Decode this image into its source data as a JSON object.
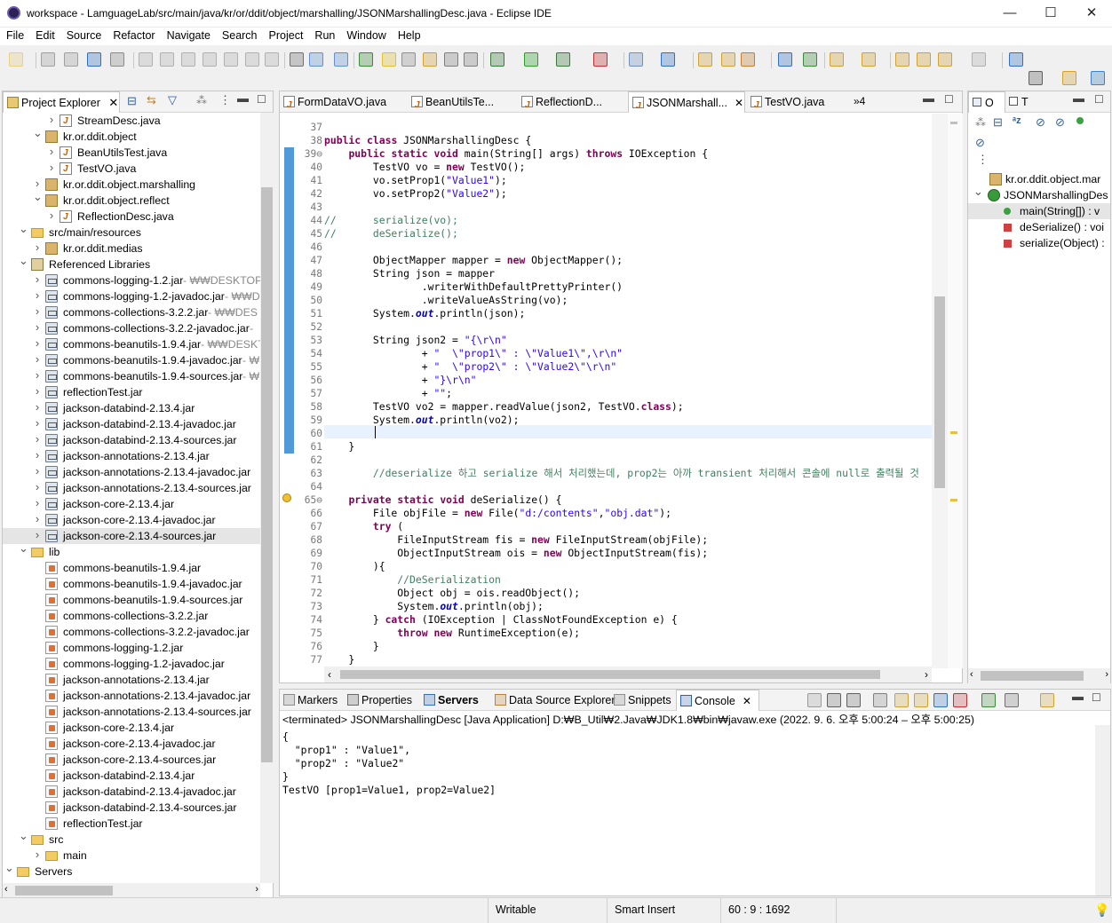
{
  "window": {
    "title": "workspace - LamguageLab/src/main/java/kr/or/ddit/object/marshalling/JSONMarshallingDesc.java - Eclipse IDE",
    "minimize": "—",
    "maximize": "☐",
    "close": "✕"
  },
  "menu": [
    "File",
    "Edit",
    "Source",
    "Refactor",
    "Navigate",
    "Search",
    "Project",
    "Run",
    "Window",
    "Help"
  ],
  "project_explorer": {
    "tab_label": "Project Explorer",
    "rows": [
      {
        "label": "StreamDesc.java",
        "extra": "",
        "indent": 4,
        "icon": "java-file-icon",
        "twisty": ">"
      },
      {
        "label": "kr.or.ddit.object",
        "extra": "",
        "indent": 3,
        "icon": "package-icon",
        "twisty": "v"
      },
      {
        "label": "BeanUtilsTest.java",
        "extra": "",
        "indent": 4,
        "icon": "java-file-icon",
        "twisty": ">"
      },
      {
        "label": "TestVO.java",
        "extra": "",
        "indent": 4,
        "icon": "java-file-icon",
        "twisty": ">"
      },
      {
        "label": "kr.or.ddit.object.marshalling",
        "extra": "",
        "indent": 3,
        "icon": "package-icon",
        "twisty": ">"
      },
      {
        "label": "kr.or.ddit.object.reflect",
        "extra": "",
        "indent": 3,
        "icon": "package-icon",
        "twisty": "v"
      },
      {
        "label": "ReflectionDesc.java",
        "extra": "",
        "indent": 4,
        "icon": "java-file-icon",
        "twisty": ">"
      },
      {
        "label": "src/main/resources",
        "extra": "",
        "indent": 2,
        "icon": "source-folder-icon",
        "twisty": "v"
      },
      {
        "label": "kr.or.ddit.medias",
        "extra": "",
        "indent": 3,
        "icon": "package-icon",
        "twisty": ">"
      },
      {
        "label": "Referenced Libraries",
        "extra": "",
        "indent": 2,
        "icon": "library-icon",
        "twisty": "v"
      },
      {
        "label": "commons-logging-1.2.jar",
        "extra": " - ₩₩DESKTOP",
        "indent": 3,
        "icon": "jar-icon",
        "twisty": ">"
      },
      {
        "label": "commons-logging-1.2-javadoc.jar",
        "extra": " - ₩₩D",
        "indent": 3,
        "icon": "jar-icon",
        "twisty": ">"
      },
      {
        "label": "commons-collections-3.2.2.jar",
        "extra": " - ₩₩DES",
        "indent": 3,
        "icon": "jar-icon",
        "twisty": ">"
      },
      {
        "label": "commons-collections-3.2.2-javadoc.jar",
        "extra": " -",
        "indent": 3,
        "icon": "jar-icon",
        "twisty": ">"
      },
      {
        "label": "commons-beanutils-1.9.4.jar",
        "extra": " - ₩₩DESKT",
        "indent": 3,
        "icon": "jar-icon",
        "twisty": ">"
      },
      {
        "label": "commons-beanutils-1.9.4-javadoc.jar",
        "extra": " - ₩",
        "indent": 3,
        "icon": "jar-icon",
        "twisty": ">"
      },
      {
        "label": "commons-beanutils-1.9.4-sources.jar",
        "extra": " - ₩",
        "indent": 3,
        "icon": "jar-icon",
        "twisty": ">"
      },
      {
        "label": "reflectionTest.jar",
        "extra": "",
        "indent": 3,
        "icon": "jar-icon",
        "twisty": ">"
      },
      {
        "label": "jackson-databind-2.13.4.jar",
        "extra": "",
        "indent": 3,
        "icon": "jar-icon",
        "twisty": ">"
      },
      {
        "label": "jackson-databind-2.13.4-javadoc.jar",
        "extra": "",
        "indent": 3,
        "icon": "jar-icon",
        "twisty": ">"
      },
      {
        "label": "jackson-databind-2.13.4-sources.jar",
        "extra": "",
        "indent": 3,
        "icon": "jar-icon",
        "twisty": ">"
      },
      {
        "label": "jackson-annotations-2.13.4.jar",
        "extra": "",
        "indent": 3,
        "icon": "jar-icon",
        "twisty": ">"
      },
      {
        "label": "jackson-annotations-2.13.4-javadoc.jar",
        "extra": "",
        "indent": 3,
        "icon": "jar-icon",
        "twisty": ">"
      },
      {
        "label": "jackson-annotations-2.13.4-sources.jar",
        "extra": "",
        "indent": 3,
        "icon": "jar-icon",
        "twisty": ">"
      },
      {
        "label": "jackson-core-2.13.4.jar",
        "extra": "",
        "indent": 3,
        "icon": "jar-icon",
        "twisty": ">"
      },
      {
        "label": "jackson-core-2.13.4-javadoc.jar",
        "extra": "",
        "indent": 3,
        "icon": "jar-icon",
        "twisty": ">"
      },
      {
        "label": "jackson-core-2.13.4-sources.jar",
        "extra": "",
        "indent": 3,
        "icon": "jar-icon",
        "twisty": ">",
        "selected": true
      },
      {
        "label": "lib",
        "extra": "",
        "indent": 2,
        "icon": "folder-icon",
        "twisty": "v"
      },
      {
        "label": "commons-beanutils-1.9.4.jar",
        "extra": "",
        "indent": 3,
        "icon": "jar-file-icon",
        "twisty": ""
      },
      {
        "label": "commons-beanutils-1.9.4-javadoc.jar",
        "extra": "",
        "indent": 3,
        "icon": "jar-file-icon",
        "twisty": ""
      },
      {
        "label": "commons-beanutils-1.9.4-sources.jar",
        "extra": "",
        "indent": 3,
        "icon": "jar-file-icon",
        "twisty": ""
      },
      {
        "label": "commons-collections-3.2.2.jar",
        "extra": "",
        "indent": 3,
        "icon": "jar-file-icon",
        "twisty": ""
      },
      {
        "label": "commons-collections-3.2.2-javadoc.jar",
        "extra": "",
        "indent": 3,
        "icon": "jar-file-icon",
        "twisty": ""
      },
      {
        "label": "commons-logging-1.2.jar",
        "extra": "",
        "indent": 3,
        "icon": "jar-file-icon",
        "twisty": ""
      },
      {
        "label": "commons-logging-1.2-javadoc.jar",
        "extra": "",
        "indent": 3,
        "icon": "jar-file-icon",
        "twisty": ""
      },
      {
        "label": "jackson-annotations-2.13.4.jar",
        "extra": "",
        "indent": 3,
        "icon": "jar-file-icon",
        "twisty": ""
      },
      {
        "label": "jackson-annotations-2.13.4-javadoc.jar",
        "extra": "",
        "indent": 3,
        "icon": "jar-file-icon",
        "twisty": ""
      },
      {
        "label": "jackson-annotations-2.13.4-sources.jar",
        "extra": "",
        "indent": 3,
        "icon": "jar-file-icon",
        "twisty": ""
      },
      {
        "label": "jackson-core-2.13.4.jar",
        "extra": "",
        "indent": 3,
        "icon": "jar-file-icon",
        "twisty": ""
      },
      {
        "label": "jackson-core-2.13.4-javadoc.jar",
        "extra": "",
        "indent": 3,
        "icon": "jar-file-icon",
        "twisty": ""
      },
      {
        "label": "jackson-core-2.13.4-sources.jar",
        "extra": "",
        "indent": 3,
        "icon": "jar-file-icon",
        "twisty": ""
      },
      {
        "label": "jackson-databind-2.13.4.jar",
        "extra": "",
        "indent": 3,
        "icon": "jar-file-icon",
        "twisty": ""
      },
      {
        "label": "jackson-databind-2.13.4-javadoc.jar",
        "extra": "",
        "indent": 3,
        "icon": "jar-file-icon",
        "twisty": ""
      },
      {
        "label": "jackson-databind-2.13.4-sources.jar",
        "extra": "",
        "indent": 3,
        "icon": "jar-file-icon",
        "twisty": ""
      },
      {
        "label": "reflectionTest.jar",
        "extra": "",
        "indent": 3,
        "icon": "jar-file-icon",
        "twisty": ""
      },
      {
        "label": "src",
        "extra": "",
        "indent": 2,
        "icon": "folder-icon",
        "twisty": "v"
      },
      {
        "label": "main",
        "extra": "",
        "indent": 3,
        "icon": "folder-icon",
        "twisty": ">"
      },
      {
        "label": "Servers",
        "extra": "",
        "indent": 1,
        "icon": "folder-icon",
        "twisty": "v"
      }
    ]
  },
  "editor": {
    "tabs": [
      {
        "label": "FormDataVO.java",
        "active": false
      },
      {
        "label": "BeanUtilsTe...",
        "active": false
      },
      {
        "label": "ReflectionD...",
        "active": false
      },
      {
        "label": "JSONMarshall...",
        "active": true
      },
      {
        "label": "TestVO.java",
        "active": false
      }
    ],
    "overflow": "»4",
    "lines": [
      {
        "n": "37",
        "html": ""
      },
      {
        "n": "38",
        "html": "<span class='kw'>public</span> <span class='kw'>class</span> JSONMarshallingDesc {"
      },
      {
        "n": "39⊖",
        "html": "    <span class='kw'>public</span> <span class='kw'>static</span> <span class='kw'>void</span> main(String[] args) <span class='kw'>throws</span> IOException {"
      },
      {
        "n": "40",
        "html": "        TestVO vo = <span class='kw'>new</span> TestVO();"
      },
      {
        "n": "41",
        "html": "        vo.setProp1(<span class='str'>\"Value1\"</span>);"
      },
      {
        "n": "42",
        "html": "        vo.setProp2(<span class='str'>\"Value2\"</span>);"
      },
      {
        "n": "43",
        "html": ""
      },
      {
        "n": "44",
        "html": "<span class='cm'>//      serialize(vo);</span>"
      },
      {
        "n": "45",
        "html": "<span class='cm'>//      deSerialize();</span>"
      },
      {
        "n": "46",
        "html": ""
      },
      {
        "n": "47",
        "html": "        ObjectMapper mapper = <span class='kw'>new</span> ObjectMapper();"
      },
      {
        "n": "48",
        "html": "        String json = mapper"
      },
      {
        "n": "49",
        "html": "                .writerWithDefaultPrettyPrinter()"
      },
      {
        "n": "50",
        "html": "                .writeValueAsString(vo);"
      },
      {
        "n": "51",
        "html": "        System.<span class='fld'>out</span>.println(json);"
      },
      {
        "n": "52",
        "html": ""
      },
      {
        "n": "53",
        "html": "        String json2 = <span class='str'>\"{\\r\\n\"</span>"
      },
      {
        "n": "54",
        "html": "                + <span class='str'>\"  \\\"prop1\\\" : \\\"Value1\\\",\\r\\n\"</span>"
      },
      {
        "n": "55",
        "html": "                + <span class='str'>\"  \\\"prop2\\\" : \\\"Value2\\\"\\r\\n\"</span>"
      },
      {
        "n": "56",
        "html": "                + <span class='str'>\"}\\r\\n\"</span>"
      },
      {
        "n": "57",
        "html": "                + <span class='str'>\"\"</span>;"
      },
      {
        "n": "58",
        "html": "        TestVO vo2 = mapper.readValue(json2, TestVO.<span class='kw'>class</span>);"
      },
      {
        "n": "59",
        "html": "        System.<span class='fld'>out</span>.println(vo2);"
      },
      {
        "n": "60",
        "html": ""
      },
      {
        "n": "61",
        "html": "    }"
      },
      {
        "n": "62",
        "html": ""
      },
      {
        "n": "63",
        "html": "        <span class='cm'>//deserialize 하고 serialize 해서 처리했는데, prop2는 아까 transient 처리해서 콘솔에 null로 출력될 것</span>"
      },
      {
        "n": "64",
        "html": ""
      },
      {
        "n": "65⊖",
        "html": "    <span class='kw'>private</span> <span class='kw'>static</span> <span class='kw'>void</span> deSerialize() {"
      },
      {
        "n": "66",
        "html": "        File objFile = <span class='kw'>new</span> File(<span class='str'>\"d:/contents\"</span>,<span class='str'>\"obj.dat\"</span>);"
      },
      {
        "n": "67",
        "html": "        <span class='kw'>try</span> ("
      },
      {
        "n": "68",
        "html": "            FileInputStream fis = <span class='kw'>new</span> FileInputStream(objFile);"
      },
      {
        "n": "69",
        "html": "            ObjectInputStream ois = <span class='kw'>new</span> ObjectInputStream(fis);"
      },
      {
        "n": "70",
        "html": "        ){"
      },
      {
        "n": "71",
        "html": "            <span class='cm'>//DeSerialization</span>"
      },
      {
        "n": "72",
        "html": "            Object obj = ois.readObject();"
      },
      {
        "n": "73",
        "html": "            System.<span class='fld'>out</span>.println(obj);"
      },
      {
        "n": "74",
        "html": "        } <span class='kw'>catch</span> (IOException | ClassNotFoundException e) {"
      },
      {
        "n": "75",
        "html": "            <span class='kw'>throw</span> <span class='kw'>new</span> RuntimeException(e);"
      },
      {
        "n": "76",
        "html": "        }"
      },
      {
        "n": "77",
        "html": "    }"
      }
    ]
  },
  "outline": {
    "tab1": "O",
    "tab2": "T",
    "rows": [
      {
        "label": "kr.or.ddit.object.mar",
        "icon": "package-icon"
      },
      {
        "label": "JSONMarshallingDes",
        "icon": "class-icon"
      },
      {
        "label": "main(String[]) : v",
        "icon": "public-method-icon"
      },
      {
        "label": "deSerialize() : voi",
        "icon": "private-method-icon"
      },
      {
        "label": "serialize(Object) :",
        "icon": "private-method-icon"
      }
    ]
  },
  "bottom": {
    "tabs": [
      {
        "label": "Markers",
        "icon": "markers-icon"
      },
      {
        "label": "Properties",
        "icon": "properties-icon"
      },
      {
        "label": "Servers",
        "icon": "servers-icon"
      },
      {
        "label": "Data Source Explorer",
        "icon": "database-icon"
      },
      {
        "label": "Snippets",
        "icon": "snippets-icon"
      },
      {
        "label": "Console",
        "icon": "console-icon",
        "active": true
      }
    ],
    "terminated": "<terminated> JSONMarshallingDesc [Java Application] D:₩B_Util₩2.Java₩JDK1.8₩bin₩javaw.exe  (2022. 9. 6. 오후 5:00:24 – 오후 5:00:25)",
    "output": "{\n  \"prop1\" : \"Value1\",\n  \"prop2\" : \"Value2\"\n}\nTestVO [prop1=Value1, prop2=Value2]"
  },
  "status": {
    "writable": "Writable",
    "insert_mode": "Smart Insert",
    "position": "60 : 9 : 1692"
  }
}
